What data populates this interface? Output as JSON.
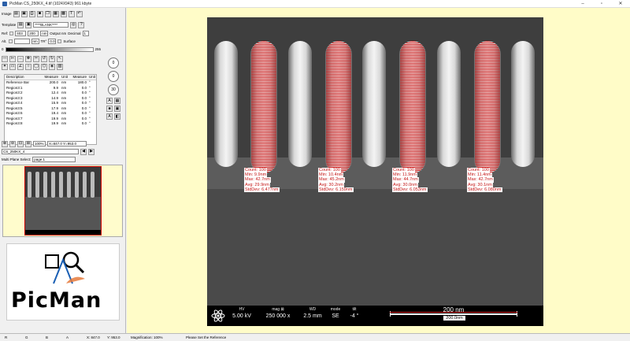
{
  "window": {
    "title": "PicMan CS_250KX_4.tif  (1024X943) 961 kbyte",
    "minimize": "–",
    "maximize": "▫",
    "close": "✕"
  },
  "toolbar": {
    "image_label": "Image",
    "template_label": "Template",
    "blank_value": "****BLANK****",
    "ref_label": "Ref:",
    "ref_x": "403",
    "ref_y": "200",
    "ref_unit": "nm",
    "output_label": "Output nm",
    "decimal_label": "Decimal",
    "decimal_value": "1",
    "alt_label": "Alt.",
    "alt_unit": "nm",
    "tr_label": "TR°",
    "tr_value": "0.0",
    "surface_label": "Surface",
    "slider_min": "0",
    "slider_max": "255",
    "gauge1": "0",
    "gauge2": "0",
    "gauge3": "30"
  },
  "table": {
    "headers": [
      "Description",
      "Measure",
      "Unit",
      "Measure",
      "Unit"
    ],
    "rows": [
      [
        "Reference Bar",
        "200.0",
        "nm",
        "180.0",
        "°"
      ],
      [
        "Region3:1",
        "9.9",
        "nm",
        "0.0",
        "°"
      ],
      [
        "Region3:2",
        "12.4",
        "nm",
        "0.0",
        "°"
      ],
      [
        "Region3:3",
        "14.9",
        "nm",
        "0.0",
        "°"
      ],
      [
        "Region3:4",
        "15.9",
        "nm",
        "0.0",
        "°"
      ],
      [
        "Region3:5",
        "17.9",
        "nm",
        "0.0",
        "°"
      ],
      [
        "Region3:6",
        "19.4",
        "nm",
        "0.0",
        "°"
      ],
      [
        "Region3:7",
        "19.9",
        "nm",
        "0.0",
        "°"
      ],
      [
        "Region3:8",
        "19.9",
        "nm",
        "0.0",
        "°"
      ]
    ]
  },
  "zoom": {
    "value": "100%",
    "coords": "X=847.0 Y=953.0"
  },
  "file_select": "CS_250KX_4",
  "multiplane": {
    "label": "Multi Plane Select:",
    "value": "page 1"
  },
  "logo": {
    "text": "PicMan"
  },
  "measurements": [
    {
      "count": "Count: 100",
      "min": "Min: 9.9nm",
      "max": "Max: 42.7nm",
      "avg": "Avg: 29.9nm",
      "std": "StdDev: 6.477nm"
    },
    {
      "count": "Count: 100",
      "min": "Min: 10.4nm",
      "max": "Max: 45.2nm",
      "avg": "Avg: 30.2nm",
      "std": "StdDev: 6.159nm"
    },
    {
      "count": "Count: 100",
      "min": "Min: 11.9nm",
      "max": "Max: 44.7nm",
      "avg": "Avg: 30.0nm",
      "std": "StdDev: 6.053nm"
    },
    {
      "count": "Count: 100",
      "min": "Min: 11.4nm",
      "max": "Max: 42.7nm",
      "avg": "Avg: 30.1nm",
      "std": "StdDev: 6.080nm"
    }
  ],
  "databar": {
    "hv_label": "HV",
    "hv_value": "5.00 kV",
    "mag_label": "mag ⊠",
    "mag_value": "250 000 x",
    "wd_label": "WD",
    "wd_value": "2.5 mm",
    "mode_label": "mode",
    "mode_value": "SE",
    "tilt_label": "tilt",
    "tilt_value": "-4 °",
    "scale_label": "200 nm",
    "scale_ref": "200.0nm"
  },
  "status": {
    "r": "R",
    "g": "G",
    "b": "B",
    "a": "A",
    "x": "X: 847.0",
    "y": "Y: 953.0",
    "magnification": "Magnification: 100%",
    "message": "Please Set the Reference"
  },
  "colors": {
    "measure_red": "#c41414",
    "background_yellow": "#fffcc8",
    "sem_gray": "#3c3c3c"
  }
}
